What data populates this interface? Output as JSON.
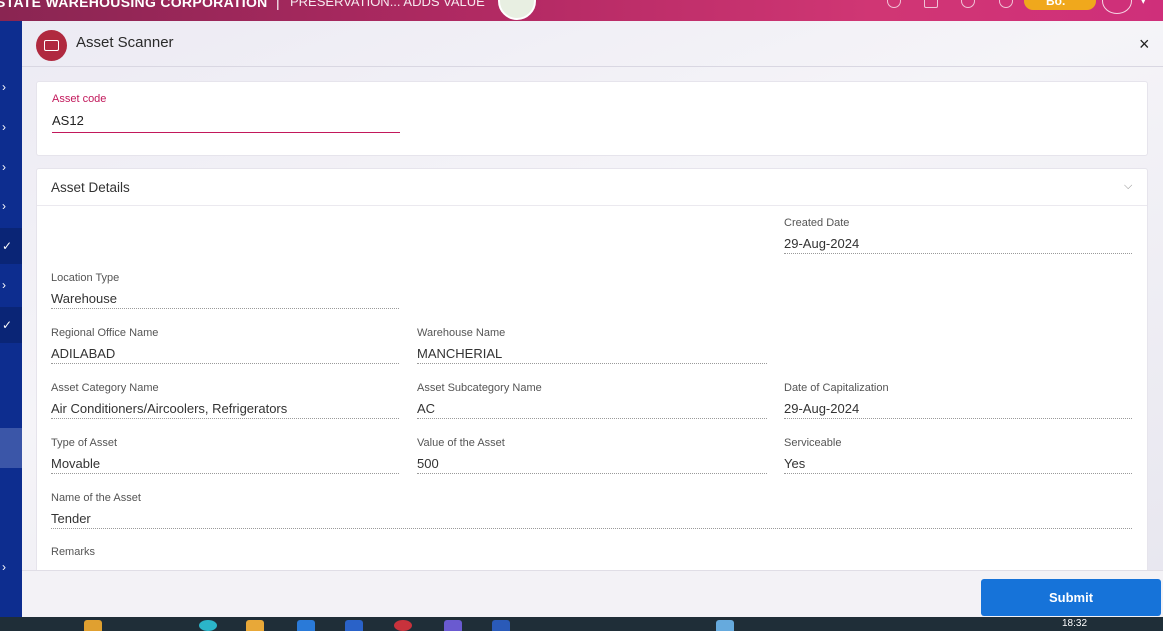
{
  "header": {
    "org_name": "STATE WAREHOUSING CORPORATION",
    "separator": "|",
    "tagline": "PRESERVATION... ADDS VALUE",
    "badge_text": "Bo.",
    "caret": "▾"
  },
  "sidebar": {
    "chevrons": [
      "›",
      "›",
      "›",
      "›",
      "✓",
      "›",
      "✓",
      "›"
    ]
  },
  "modal": {
    "title": "Asset Scanner",
    "close_icon": "×",
    "asset_code": {
      "label": "Asset code",
      "value": "AS12"
    },
    "details": {
      "title": "Asset Details",
      "chevron": "⌵",
      "fields": {
        "created_date": {
          "label": "Created Date",
          "value": "29-Aug-2024"
        },
        "location_type": {
          "label": "Location Type",
          "value": "Warehouse"
        },
        "regional_office": {
          "label": "Regional Office Name",
          "value": "ADILABAD"
        },
        "warehouse_name": {
          "label": "Warehouse Name",
          "value": "MANCHERIAL"
        },
        "asset_category": {
          "label": "Asset Category Name",
          "value": "Air Conditioners/Aircoolers, Refrigerators"
        },
        "asset_subcategory": {
          "label": "Asset Subcategory Name",
          "value": "AC"
        },
        "date_of_capitalization": {
          "label": "Date of Capitalization",
          "value": "29-Aug-2024"
        },
        "type_of_asset": {
          "label": "Type of Asset",
          "value": "Movable"
        },
        "value_of_asset": {
          "label": "Value of the Asset",
          "value": "500"
        },
        "serviceable": {
          "label": "Serviceable",
          "value": "Yes"
        },
        "name_of_asset": {
          "label": "Name of the Asset",
          "value": "Tender"
        },
        "remarks": {
          "label": "Remarks"
        }
      }
    },
    "submit_label": "Submit"
  },
  "taskbar": {
    "clock": "18:32",
    "icon_colors": [
      "#e0a030",
      "#2bb5c9",
      "#e8a838",
      "#2a7ad8",
      "#2a62c8",
      "#c8323c",
      "#6a5ad0",
      "#2a5ab8",
      "#66aadd"
    ]
  }
}
